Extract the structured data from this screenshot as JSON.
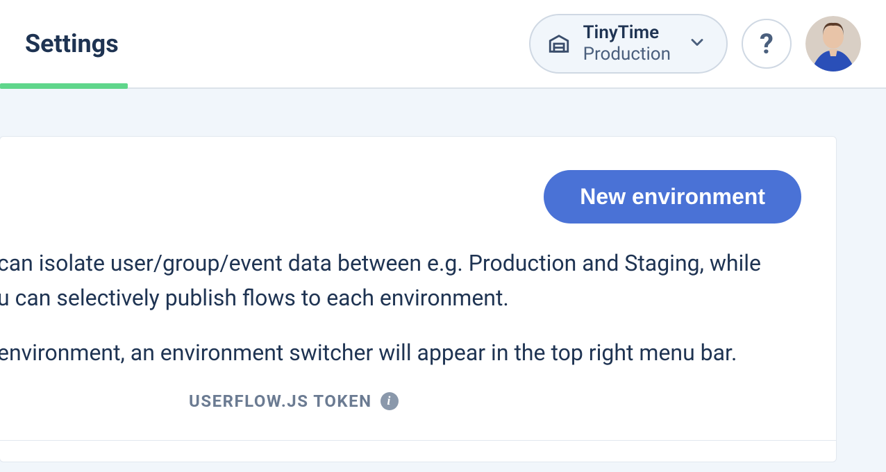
{
  "header": {
    "title": "Settings",
    "env_switcher": {
      "name": "TinyTime",
      "environment": "Production"
    },
    "help_label": "?"
  },
  "main": {
    "new_env_button": "New environment",
    "description_line1": "can isolate user/group/event data between e.g. Production and Staging, while",
    "description_line2": "u can selectively publish flows to each environment.",
    "description_line3": "environment, an environment switcher will appear in the top right menu bar.",
    "columns": {
      "token_header": "USERFLOW.JS TOKEN"
    }
  }
}
